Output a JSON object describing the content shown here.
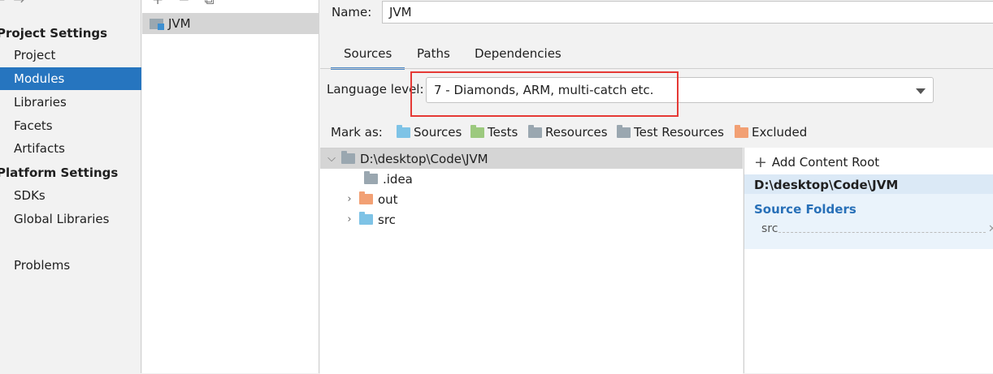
{
  "sidebar": {
    "project_settings_heading": "Project Settings",
    "project_items": [
      "Project",
      "Modules",
      "Libraries",
      "Facets",
      "Artifacts"
    ],
    "platform_settings_heading": "Platform Settings",
    "platform_items": [
      "SDKs",
      "Global Libraries"
    ],
    "problems_label": "Problems",
    "selected": "Modules"
  },
  "modules_list": {
    "items": [
      {
        "name": "JVM",
        "selected": true
      }
    ]
  },
  "detail": {
    "name_label": "Name:",
    "name_value": "JVM",
    "tabs": [
      "Sources",
      "Paths",
      "Dependencies"
    ],
    "active_tab": "Sources",
    "language_level_label": "Language level:",
    "language_level_value": "7 - Diamonds, ARM, multi-catch etc.",
    "mark_as_label": "Mark as:",
    "mark_as_options": [
      {
        "label": "Sources",
        "color": "#7ec3e6"
      },
      {
        "label": "Tests",
        "color": "#9cc97e"
      },
      {
        "label": "Resources",
        "color": "#9aa7b0"
      },
      {
        "label": "Test Resources",
        "color": "#9aa7b0"
      },
      {
        "label": "Excluded",
        "color": "#f2a074"
      }
    ]
  },
  "tree": {
    "root": "D:\\desktop\\Code\\JVM",
    "children": [
      {
        "name": ".idea",
        "expandable": false,
        "color": "#9aa7b0"
      },
      {
        "name": "out",
        "expandable": true,
        "color": "#f2a074"
      },
      {
        "name": "src",
        "expandable": true,
        "color": "#7ec3e6"
      }
    ]
  },
  "content_root": {
    "add_label": "Add Content Root",
    "path": "D:\\desktop\\Code\\JVM",
    "source_folders_heading": "Source Folders",
    "source_folders": [
      "src"
    ]
  },
  "colors": {
    "selection": "#2675bf",
    "highlight_box": "#e53935",
    "source_folders_heading": "#2870b8"
  }
}
